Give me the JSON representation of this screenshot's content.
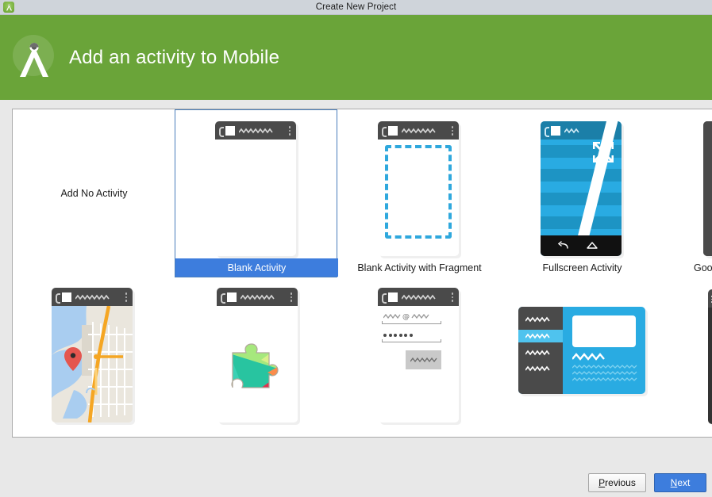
{
  "window": {
    "title": "Create New Project",
    "icon": "android-studio-icon"
  },
  "header": {
    "title": "Add an activity to Mobile",
    "logo_icon": "android-studio-compass-icon",
    "background_color": "#6aa439"
  },
  "gallery": {
    "selected_index": 1,
    "selection_color": "#3d7ddd",
    "tiles": [
      {
        "label": "Add No Activity",
        "art": "none",
        "selected": false
      },
      {
        "label": "Blank Activity",
        "art": "blank-phone",
        "selected": true
      },
      {
        "label": "Blank Activity with Fragment",
        "art": "fragment-phone",
        "selected": false
      },
      {
        "label": "Fullscreen Activity",
        "art": "fullscreen-phone",
        "selected": false
      },
      {
        "label": "Googl",
        "art": "google-maps-phone-partial",
        "selected": false
      },
      {
        "label": "",
        "art": "maps-phone",
        "selected": false
      },
      {
        "label": "",
        "art": "play-services-phone",
        "selected": false
      },
      {
        "label": "",
        "art": "login-phone",
        "selected": false
      },
      {
        "label": "",
        "art": "master-detail-tablet",
        "selected": false
      },
      {
        "label": "",
        "art": "navigation-drawer-partial",
        "selected": false
      }
    ]
  },
  "footer": {
    "previous": {
      "label": "Previous",
      "mnemonic": "P"
    },
    "next": {
      "label": "Next",
      "mnemonic": "N"
    }
  }
}
